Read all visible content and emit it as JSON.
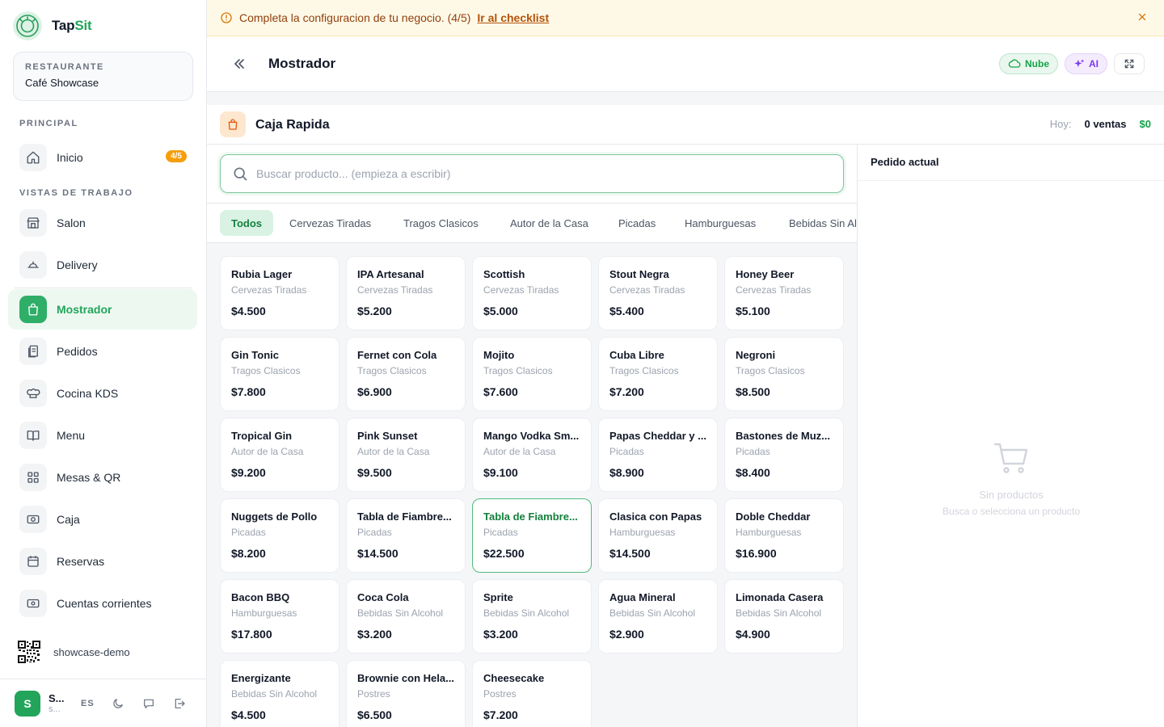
{
  "brand": {
    "name_main": "Tap",
    "name_accent": "Sit"
  },
  "restaurant": {
    "label": "RESTAURANTE",
    "name": "Café Showcase"
  },
  "sidebar": {
    "section_principal": "PRINCIPAL",
    "section_vistas": "VISTAS DE TRABAJO",
    "items": [
      {
        "label": "Inicio",
        "badge": "4/5"
      },
      {
        "label": "Salon"
      },
      {
        "label": "Delivery"
      },
      {
        "label": "Mostrador"
      },
      {
        "label": "Pedidos"
      },
      {
        "label": "Cocina KDS"
      },
      {
        "label": "Menu"
      },
      {
        "label": "Mesas & QR"
      },
      {
        "label": "Caja"
      },
      {
        "label": "Reservas"
      },
      {
        "label": "Cuentas corrientes"
      }
    ],
    "qr_label": "showcase-demo",
    "user": {
      "avatar": "S",
      "name": "S...",
      "sub": "s...",
      "lang": "ES"
    }
  },
  "banner": {
    "text": "Completa la configuracion de tu negocio. (4/5)",
    "link": "Ir al checklist"
  },
  "header": {
    "title": "Mostrador",
    "cloud_label": "Nube",
    "ai_label": "AI"
  },
  "caja": {
    "title": "Caja Rapida",
    "today_label": "Hoy:",
    "sales": "0 ventas",
    "total": "$0"
  },
  "search": {
    "placeholder": "Buscar producto... (empieza a escribir)"
  },
  "categories": [
    "Todos",
    "Cervezas Tiradas",
    "Tragos Clasicos",
    "Autor de la Casa",
    "Picadas",
    "Hamburguesas",
    "Bebidas Sin Alcohol"
  ],
  "products": [
    {
      "name": "Rubia Lager",
      "category": "Cervezas Tiradas",
      "price": "$4.500"
    },
    {
      "name": "IPA Artesanal",
      "category": "Cervezas Tiradas",
      "price": "$5.200"
    },
    {
      "name": "Scottish",
      "category": "Cervezas Tiradas",
      "price": "$5.000"
    },
    {
      "name": "Stout Negra",
      "category": "Cervezas Tiradas",
      "price": "$5.400"
    },
    {
      "name": "Honey Beer",
      "category": "Cervezas Tiradas",
      "price": "$5.100"
    },
    {
      "name": "Gin Tonic",
      "category": "Tragos Clasicos",
      "price": "$7.800"
    },
    {
      "name": "Fernet con Cola",
      "category": "Tragos Clasicos",
      "price": "$6.900"
    },
    {
      "name": "Mojito",
      "category": "Tragos Clasicos",
      "price": "$7.600"
    },
    {
      "name": "Cuba Libre",
      "category": "Tragos Clasicos",
      "price": "$7.200"
    },
    {
      "name": "Negroni",
      "category": "Tragos Clasicos",
      "price": "$8.500"
    },
    {
      "name": "Tropical Gin",
      "category": "Autor de la Casa",
      "price": "$9.200"
    },
    {
      "name": "Pink Sunset",
      "category": "Autor de la Casa",
      "price": "$9.500"
    },
    {
      "name": "Mango Vodka Sm...",
      "category": "Autor de la Casa",
      "price": "$9.100"
    },
    {
      "name": "Papas Cheddar y ...",
      "category": "Picadas",
      "price": "$8.900"
    },
    {
      "name": "Bastones de Muz...",
      "category": "Picadas",
      "price": "$8.400"
    },
    {
      "name": "Nuggets de Pollo",
      "category": "Picadas",
      "price": "$8.200"
    },
    {
      "name": "Tabla de Fiambre...",
      "category": "Picadas",
      "price": "$14.500"
    },
    {
      "name": "Tabla de Fiambre...",
      "category": "Picadas",
      "price": "$22.500"
    },
    {
      "name": "Clasica con Papas",
      "category": "Hamburguesas",
      "price": "$14.500"
    },
    {
      "name": "Doble Cheddar",
      "category": "Hamburguesas",
      "price": "$16.900"
    },
    {
      "name": "Bacon BBQ",
      "category": "Hamburguesas",
      "price": "$17.800"
    },
    {
      "name": "Coca Cola",
      "category": "Bebidas Sin Alcohol",
      "price": "$3.200"
    },
    {
      "name": "Sprite",
      "category": "Bebidas Sin Alcohol",
      "price": "$3.200"
    },
    {
      "name": "Agua Mineral",
      "category": "Bebidas Sin Alcohol",
      "price": "$2.900"
    },
    {
      "name": "Limonada Casera",
      "category": "Bebidas Sin Alcohol",
      "price": "$4.900"
    },
    {
      "name": "Energizante",
      "category": "Bebidas Sin Alcohol",
      "price": "$4.500"
    },
    {
      "name": "Brownie con Hela...",
      "category": "Postres",
      "price": "$6.500"
    },
    {
      "name": "Cheesecake",
      "category": "Postres",
      "price": "$7.200"
    }
  ],
  "order": {
    "title": "Pedido actual",
    "empty_title": "Sin productos",
    "empty_sub": "Busca o selecciona un producto"
  },
  "colors": {
    "accent": "#22a55a",
    "warning": "#f59e0b",
    "ai": "#7c3aed"
  }
}
